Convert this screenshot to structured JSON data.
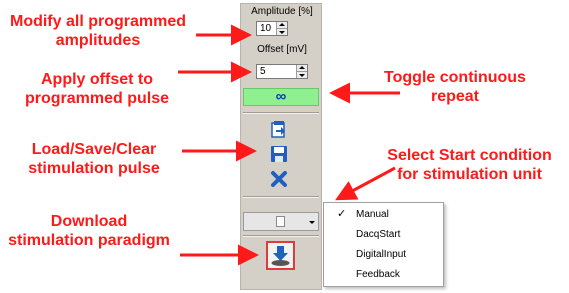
{
  "annotations": {
    "modify_line1": "Modify all programmed",
    "modify_line2": "amplitudes",
    "offset_line1": "Apply offset to",
    "offset_line2": "programmed pulse",
    "repeat_line1": "Toggle continuous",
    "repeat_line2": "repeat",
    "load_line1": "Load/Save/Clear",
    "load_line2": "stimulation pulse",
    "start_line1": "Select Start condition",
    "start_line2": "for stimulation unit",
    "download_line1": "Download",
    "download_line2": "stimulation paradigm"
  },
  "panel": {
    "amplitude_label": "Amplitude [%]",
    "amplitude_value": "10",
    "offset_label": "Offset [mV]",
    "offset_value": "5",
    "repeat_symbol": "∞",
    "repeat_active_color": "#8ef08e",
    "icons": [
      "load-icon",
      "save-icon",
      "clear-icon",
      "document-icon",
      "download-icon"
    ]
  },
  "start_menu": {
    "checkmark": "✓",
    "selected": "Manual",
    "options": [
      "Manual",
      "DacqStart",
      "DigitalInput",
      "Feedback"
    ]
  },
  "colors": {
    "annotation_red": "#ff1a1a",
    "panel_bg": "#d4d0c8",
    "icon_blue": "#1f5fbf"
  }
}
